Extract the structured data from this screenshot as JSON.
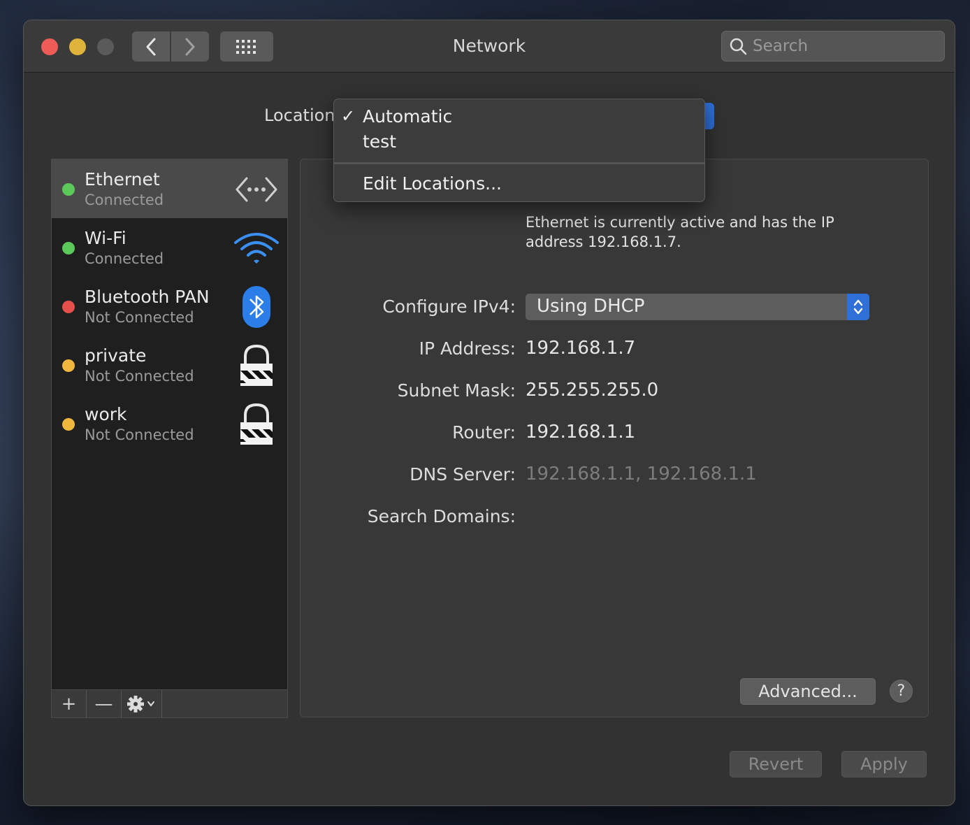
{
  "window": {
    "title": "Network",
    "search_placeholder": "Search"
  },
  "location": {
    "label": "Location:",
    "menu": {
      "items": [
        {
          "label": "Automatic",
          "checked": "✓"
        },
        {
          "label": "test",
          "checked": ""
        }
      ],
      "edit_label": "Edit Locations..."
    }
  },
  "services": [
    {
      "name": "Ethernet",
      "status": "Connected",
      "status_color": "#5bc85a",
      "icon": "ethernet-icon",
      "selected": true
    },
    {
      "name": "Wi-Fi",
      "status": "Connected",
      "status_color": "#5bc85a",
      "icon": "wifi-icon",
      "selected": false
    },
    {
      "name": "Bluetooth PAN",
      "status": "Not Connected",
      "status_color": "#e5504a",
      "icon": "bluetooth-icon",
      "selected": false
    },
    {
      "name": "private",
      "status": "Not Connected",
      "status_color": "#f0b73f",
      "icon": "vpn-lock-icon",
      "selected": false
    },
    {
      "name": "work",
      "status": "Not Connected",
      "status_color": "#f0b73f",
      "icon": "vpn-lock-icon",
      "selected": false
    }
  ],
  "sidebar_tools": {
    "add": "+",
    "remove": "—"
  },
  "details": {
    "status_message": "Ethernet is currently active and has the IP address 192.168.1.7.",
    "configure_ipv4_label": "Configure IPv4:",
    "configure_ipv4_value": "Using DHCP",
    "ip_address_label": "IP Address:",
    "ip_address_value": "192.168.1.7",
    "subnet_mask_label": "Subnet Mask:",
    "subnet_mask_value": "255.255.255.0",
    "router_label": "Router:",
    "router_value": "192.168.1.1",
    "dns_server_label": "DNS Server:",
    "dns_server_value": "192.168.1.1, 192.168.1.1",
    "search_domains_label": "Search Domains:"
  },
  "buttons": {
    "advanced": "Advanced...",
    "help": "?",
    "revert": "Revert",
    "apply": "Apply"
  },
  "colors": {
    "accent": "#2f6fd8",
    "window_bg": "#323232",
    "sidebar_bg": "#1f1f1f"
  }
}
